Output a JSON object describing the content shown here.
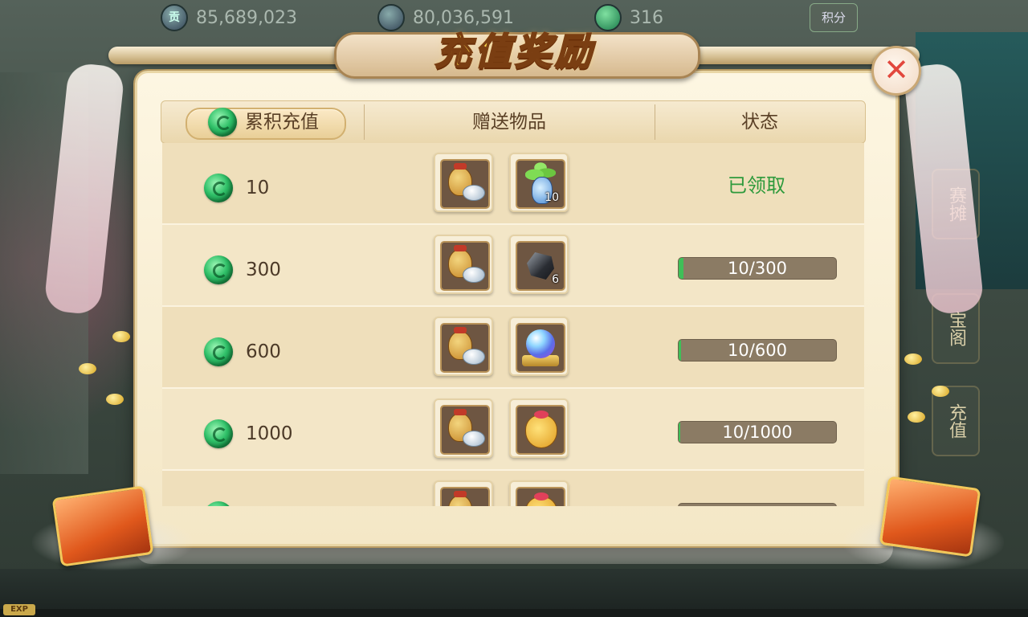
{
  "currency": {
    "gong_icon_text": "贡",
    "gong_value": "85,689,023",
    "silver_value": "80,036,591",
    "jade_value": "316",
    "score_label": "积分"
  },
  "side_buttons": [
    "赛摊",
    "宝阁",
    "充值"
  ],
  "exp_label": "EXP",
  "title": "充值奖励",
  "close_symbol": "✕",
  "header": {
    "cumulative": "累积充值",
    "gifts": "赠送物品",
    "status": "状态"
  },
  "rows": [
    {
      "amount": "10",
      "items": [
        {
          "icon": "coin-bag-silver-icon",
          "count": ""
        },
        {
          "icon": "herb-vase-icon",
          "count": "10"
        }
      ],
      "status_type": "claimed",
      "status_text": "已领取",
      "progress": 1.0
    },
    {
      "amount": "300",
      "items": [
        {
          "icon": "coin-bag-silver-icon",
          "count": ""
        },
        {
          "icon": "dark-ore-icon",
          "count": "6"
        }
      ],
      "status_type": "progress",
      "status_text": "10/300",
      "progress": 0.033
    },
    {
      "amount": "600",
      "items": [
        {
          "icon": "coin-bag-silver-icon",
          "count": ""
        },
        {
          "icon": "crystal-orb-icon",
          "count": ""
        }
      ],
      "status_type": "progress",
      "status_text": "10/600",
      "progress": 0.017
    },
    {
      "amount": "1000",
      "items": [
        {
          "icon": "coin-bag-silver-icon",
          "count": ""
        },
        {
          "icon": "lucky-pouch-icon",
          "count": ""
        }
      ],
      "status_type": "progress",
      "status_text": "10/1000",
      "progress": 0.01
    },
    {
      "amount": "",
      "items": [
        {
          "icon": "coin-bag-silver-icon",
          "count": ""
        },
        {
          "icon": "lucky-pouch-icon",
          "count": ""
        }
      ],
      "status_type": "progress",
      "status_text": "",
      "progress": 0.0
    }
  ],
  "colors": {
    "title_gold": "#fbd64a",
    "claimed_green": "#2e9a3c",
    "progress_track": "#8b7b64",
    "progress_fill": "#3fbf58",
    "close_red": "#e2483e"
  }
}
